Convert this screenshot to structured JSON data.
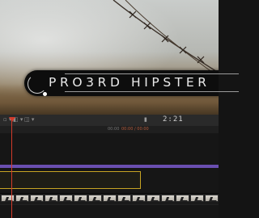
{
  "viewer": {
    "title_text": "PRO3RD HIPSTER"
  },
  "toolbar": {
    "left_items": [
      "▫ ▾",
      "◧ ▾",
      "◫ ▾"
    ],
    "timecode": "2:21",
    "right_glyph": "▮"
  },
  "ruler": {
    "label": "00:00",
    "range": "00:00 / 00:00"
  },
  "colors": {
    "playhead": "#d23a2a",
    "purple_track": "#6a4fb0",
    "selected_clip_border": "#c7a423"
  }
}
